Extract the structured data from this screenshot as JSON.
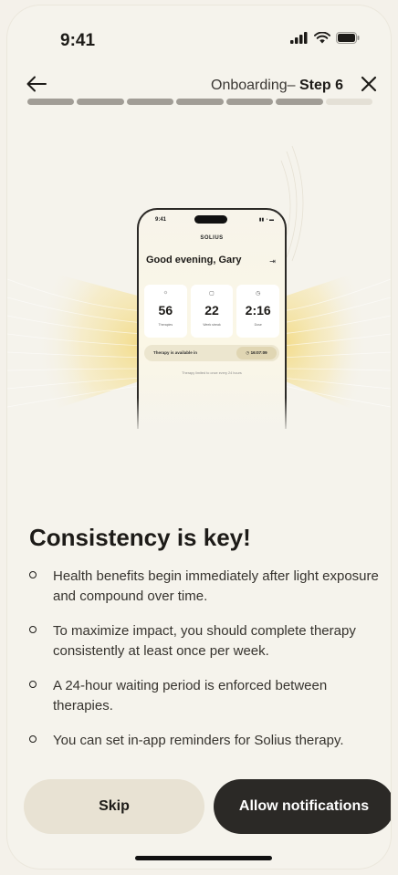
{
  "status_bar": {
    "time": "9:41"
  },
  "nav": {
    "step_prefix": "Onboarding– ",
    "step_label": "Step 6",
    "progress": {
      "total": 7,
      "completed": 6
    }
  },
  "preview": {
    "time": "9:41",
    "brand": "SOLIUS",
    "greeting": "Good evening, Gary",
    "cards": [
      {
        "icon": "sun-icon",
        "glyph": "☼",
        "value": "56",
        "label": "Therapies"
      },
      {
        "icon": "calendar-icon",
        "glyph": "▢",
        "value": "22",
        "label": "Week streak"
      },
      {
        "icon": "clock-icon",
        "glyph": "◷",
        "value": "2:16",
        "label": "Dose"
      }
    ],
    "availability_text": "Therapy is available in",
    "timer": "◷ 16:07:09",
    "note": "Therapy limited to once every 24 hours"
  },
  "content": {
    "heading": "Consistency is key!",
    "bullets": [
      "Health benefits begin immediately after light exposure and compound over time.",
      "To maximize impact, you should complete therapy consistently at least once per week.",
      "A 24-hour waiting period is enforced between therapies.",
      "You can set in-app reminders for Solius therapy."
    ]
  },
  "actions": {
    "skip_label": "Skip",
    "allow_label": "Allow notifications"
  },
  "colors": {
    "background": "#f5f3ec",
    "primary_button": "#2b2926",
    "secondary_button": "#e8e2d3",
    "glow": "#f3dc8a"
  }
}
